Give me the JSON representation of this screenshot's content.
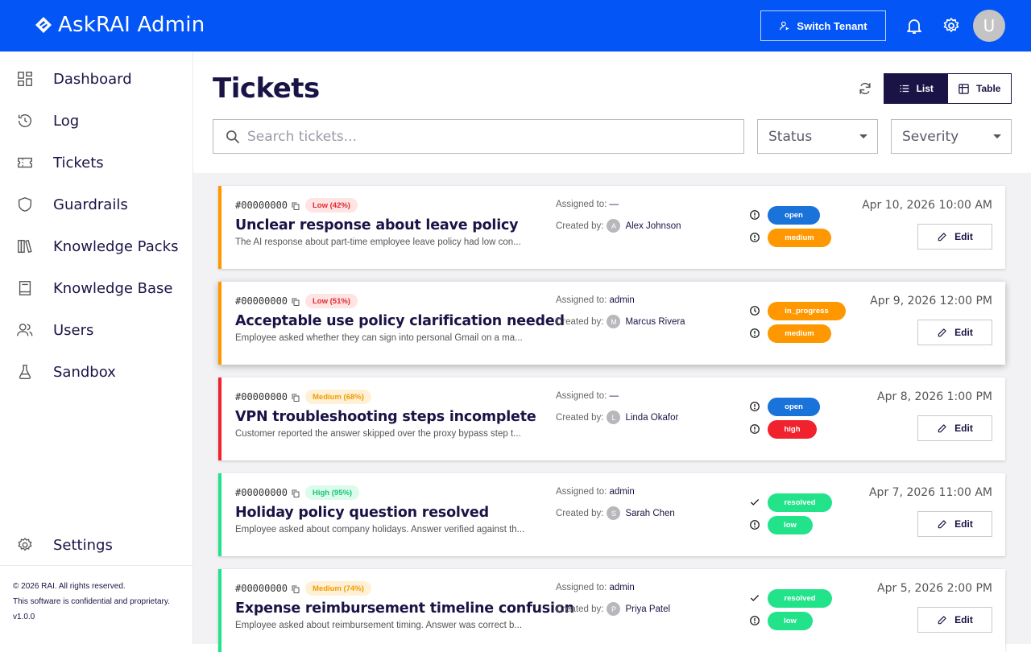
{
  "app": {
    "title": "AskRAI Admin",
    "switch_tenant": "Switch Tenant",
    "avatar_letter": "U"
  },
  "sidebar": {
    "items": [
      {
        "label": "Dashboard",
        "icon": "dashboard-icon"
      },
      {
        "label": "Log",
        "icon": "history-icon"
      },
      {
        "label": "Tickets",
        "icon": "ticket-icon"
      },
      {
        "label": "Guardrails",
        "icon": "shield-icon"
      },
      {
        "label": "Knowledge Packs",
        "icon": "books-icon"
      },
      {
        "label": "Knowledge Base",
        "icon": "book-icon"
      },
      {
        "label": "Users",
        "icon": "users-icon"
      },
      {
        "label": "Sandbox",
        "icon": "flask-icon"
      }
    ],
    "settings": "Settings",
    "footer": {
      "copyright": "© 2026 RAI. All rights reserved.",
      "notice": "This software is confidential and proprietary.",
      "version": "v1.0.0"
    }
  },
  "main": {
    "title": "Tickets",
    "view": {
      "list": "List",
      "table": "Table",
      "active": "list"
    },
    "search": {
      "placeholder": "Search tickets..."
    },
    "filters": {
      "status": "Status",
      "severity": "Severity"
    }
  },
  "labels": {
    "assigned": "Assigned to:",
    "created": "Created by:",
    "edit": "Edit"
  },
  "colors": {
    "primary": "#0355f5",
    "dark": "#1a1446",
    "open": "#1a73d9",
    "in_progress": "#ff9800",
    "resolved": "#22e38a",
    "medium": "#ff9800",
    "high": "#f0222e",
    "low": "#22e38a"
  },
  "tickets": [
    {
      "id": "#00000000",
      "confidence": "Low (42%)",
      "title": "Unclear response about leave policy",
      "description": "The AI response about part-time employee leave policy had low con...",
      "assigned": "—",
      "creator": "Alex Johnson",
      "initial": "A",
      "status": "open",
      "severity": "medium",
      "date": "Apr 10, 2026 10:00 AM"
    },
    {
      "id": "#00000000",
      "confidence": "Low (51%)",
      "title": "Acceptable use policy clarification needed",
      "description": "Employee asked whether they can sign into personal Gmail on a ma...",
      "assigned": "admin",
      "creator": "Marcus Rivera",
      "initial": "M",
      "status": "in_progress",
      "severity": "medium",
      "date": "Apr 9, 2026 12:00 PM"
    },
    {
      "id": "#00000000",
      "confidence": "Medium (68%)",
      "title": "VPN troubleshooting steps incomplete",
      "description": "Customer reported the answer skipped over the proxy bypass step t...",
      "assigned": "—",
      "creator": "Linda Okafor",
      "initial": "L",
      "status": "open",
      "severity": "high",
      "date": "Apr 8, 2026 1:00 PM"
    },
    {
      "id": "#00000000",
      "confidence": "High (95%)",
      "title": "Holiday policy question resolved",
      "description": "Employee asked about company holidays. Answer verified against th...",
      "assigned": "admin",
      "creator": "Sarah Chen",
      "initial": "S",
      "status": "resolved",
      "severity": "low",
      "date": "Apr 7, 2026 11:00 AM"
    },
    {
      "id": "#00000000",
      "confidence": "Medium (74%)",
      "title": "Expense reimbursement timeline confusion",
      "description": "Employee asked about reimbursement timing. Answer was correct b...",
      "assigned": "admin",
      "creator": "Priya Patel",
      "initial": "P",
      "status": "resolved",
      "severity": "low",
      "date": "Apr 5, 2026 2:00 PM"
    }
  ]
}
